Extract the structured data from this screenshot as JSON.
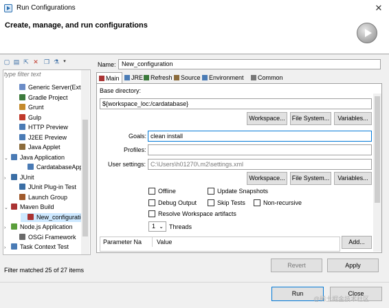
{
  "window": {
    "title": "Run Configurations",
    "close_icon": "close-icon"
  },
  "header": {
    "title": "Create, manage, and run configurations"
  },
  "toolbar": {
    "icons": [
      "new-config-icon",
      "new-prototype-icon",
      "export-icon",
      "delete-icon",
      "duplicate-icon",
      "filter-icon",
      "dropdown-icon"
    ]
  },
  "sidebar": {
    "filter_placeholder": "type filter text",
    "items": [
      {
        "label": "Generic Server(Exte",
        "indent": 1,
        "twisty": "",
        "icon_color": "#6b8cc7"
      },
      {
        "label": "Gradle Project",
        "indent": 1,
        "twisty": "",
        "icon_color": "#3c7a3c"
      },
      {
        "label": "Grunt",
        "indent": 1,
        "twisty": "",
        "icon_color": "#c48a2c"
      },
      {
        "label": "Gulp",
        "indent": 1,
        "twisty": "",
        "icon_color": "#c0392b"
      },
      {
        "label": "HTTP Preview",
        "indent": 1,
        "twisty": "",
        "icon_color": "#4a7bb5"
      },
      {
        "label": "J2EE Preview",
        "indent": 1,
        "twisty": "",
        "icon_color": "#4a7bb5"
      },
      {
        "label": "Java Applet",
        "indent": 1,
        "twisty": "",
        "icon_color": "#8b6b3b"
      },
      {
        "label": "Java Application",
        "indent": 0,
        "twisty": "v",
        "icon_color": "#4a7bb5"
      },
      {
        "label": "CardatabaseApp",
        "indent": 2,
        "twisty": "",
        "icon_color": "#4a7bb5"
      },
      {
        "label": "JUnit",
        "indent": 0,
        "twisty": ">",
        "icon_color": "#3a6ea5"
      },
      {
        "label": "JUnit Plug-in Test",
        "indent": 1,
        "twisty": "",
        "icon_color": "#3a6ea5"
      },
      {
        "label": "Launch Group",
        "indent": 1,
        "twisty": "",
        "icon_color": "#a05a2c"
      },
      {
        "label": "Maven Build",
        "indent": 0,
        "twisty": "v",
        "icon_color": "#a33"
      },
      {
        "label": "New_configuration",
        "indent": 2,
        "twisty": "",
        "icon_color": "#a33"
      },
      {
        "label": "Node.js Application",
        "indent": 0,
        "twisty": ">",
        "icon_color": "#5a9e3a"
      },
      {
        "label": "OSGi Framework",
        "indent": 1,
        "twisty": "",
        "icon_color": "#6a6a6a"
      },
      {
        "label": "Task Context Test",
        "indent": 0,
        "twisty": ">",
        "icon_color": "#4a7bb5"
      }
    ],
    "selected_index": 13,
    "status": "Filter matched 25 of 27 items"
  },
  "config": {
    "name_label": "Name:",
    "name_value": "New_configuration",
    "tabs": [
      {
        "label": "Main",
        "icon_color": "#a33"
      },
      {
        "label": "JRE",
        "icon_color": "#4a7bb5"
      },
      {
        "label": "Refresh",
        "icon_color": "#3c7a3c"
      },
      {
        "label": "Source",
        "icon_color": "#8b6b3b"
      },
      {
        "label": "Environment",
        "icon_color": "#4a7bb5"
      },
      {
        "label": "Common",
        "icon_color": "#777"
      }
    ],
    "active_tab": 0,
    "base_dir_label": "Base directory:",
    "base_dir_value": "${workspace_loc:/cardatabase}",
    "buttons_row1": [
      "Workspace...",
      "File System...",
      "Variables..."
    ],
    "goals_label": "Goals:",
    "goals_value": "clean install",
    "profiles_label": "Profiles:",
    "profiles_value": "",
    "user_settings_label": "User settings:",
    "user_settings_value": "C:\\Users\\h01270\\.m2\\settings.xml",
    "buttons_row2": [
      "Workspace...",
      "File System...",
      "Variables..."
    ],
    "checkboxes": {
      "offline": "Offline",
      "update_snapshots": "Update Snapshots",
      "debug_output": "Debug Output",
      "skip_tests": "Skip Tests",
      "non_recursive": "Non-recursive",
      "resolve_workspace": "Resolve Workspace artifacts"
    },
    "threads_value": "1",
    "threads_label": "Threads",
    "param_col_name": "Parameter Na",
    "param_col_value": "Value",
    "add_button": "Add..."
  },
  "actions": {
    "revert": "Revert",
    "apply": "Apply",
    "run": "Run",
    "close": "Close"
  },
  "watermark": "@稀土掘金技术社区"
}
